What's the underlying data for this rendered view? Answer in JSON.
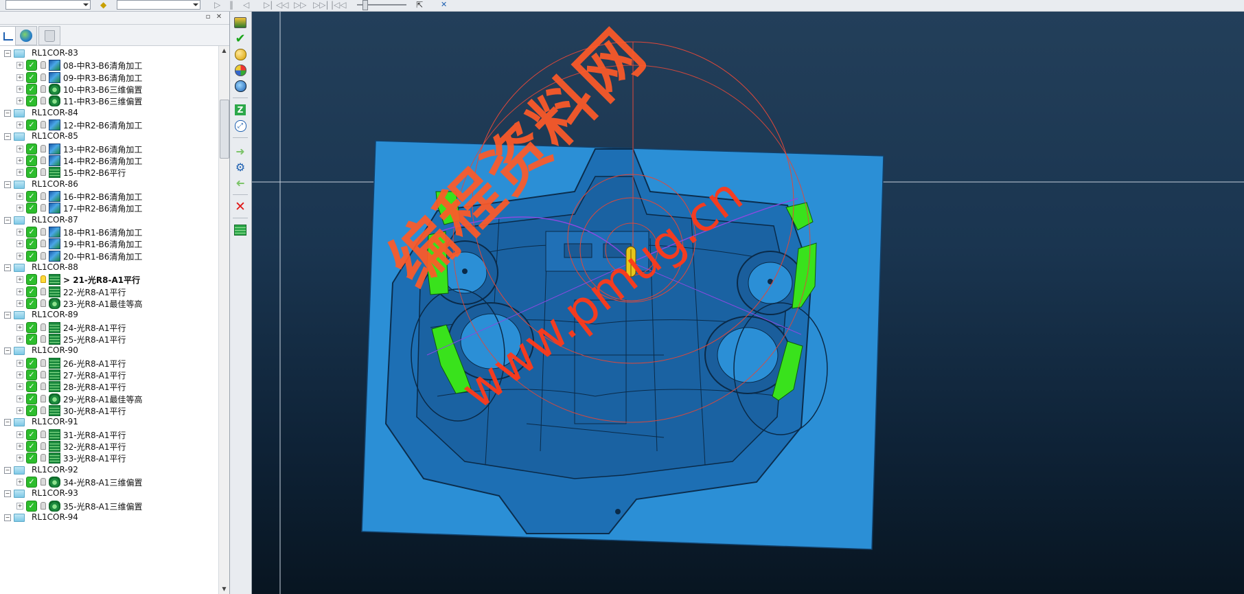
{
  "watermark": {
    "chinese": "编程资料网",
    "url": "www.pmug.cn"
  },
  "tree": {
    "rows": [
      {
        "kind": "group",
        "label": "RL1COR-83"
      },
      {
        "kind": "op",
        "label": "08-中R3-B6清角加工",
        "icon": "tool-corner-icon",
        "bulb": "off"
      },
      {
        "kind": "op",
        "label": "09-中R3-B6清角加工",
        "icon": "tool-corner-icon",
        "bulb": "off"
      },
      {
        "kind": "op",
        "label": "10-中R3-B6三维偏置",
        "icon": "tool-offset-icon",
        "bulb": "off"
      },
      {
        "kind": "op",
        "label": "11-中R3-B6三维偏置",
        "icon": "tool-offset-icon",
        "bulb": "off"
      },
      {
        "kind": "group",
        "label": "RL1COR-84"
      },
      {
        "kind": "op",
        "label": "12-中R2-B6清角加工",
        "icon": "tool-corner-icon",
        "bulb": "off"
      },
      {
        "kind": "group",
        "label": "RL1COR-85"
      },
      {
        "kind": "op",
        "label": "13-中R2-B6清角加工",
        "icon": "tool-corner-icon",
        "bulb": "off"
      },
      {
        "kind": "op",
        "label": "14-中R2-B6清角加工",
        "icon": "tool-corner-icon",
        "bulb": "off"
      },
      {
        "kind": "op",
        "label": "15-中R2-B6平行",
        "icon": "tool-parallel-icon",
        "bulb": "off"
      },
      {
        "kind": "group",
        "label": "RL1COR-86"
      },
      {
        "kind": "op",
        "label": "16-中R2-B6清角加工",
        "icon": "tool-corner-icon",
        "bulb": "off"
      },
      {
        "kind": "op",
        "label": "17-中R2-B6清角加工",
        "icon": "tool-corner-icon",
        "bulb": "off"
      },
      {
        "kind": "group",
        "label": "RL1COR-87"
      },
      {
        "kind": "op",
        "label": "18-中R1-B6清角加工",
        "icon": "tool-corner-icon",
        "bulb": "off"
      },
      {
        "kind": "op",
        "label": "19-中R1-B6清角加工",
        "icon": "tool-corner-icon",
        "bulb": "off"
      },
      {
        "kind": "op",
        "label": "20-中R1-B6清角加工",
        "icon": "tool-corner-icon",
        "bulb": "off"
      },
      {
        "kind": "group",
        "label": "RL1COR-88"
      },
      {
        "kind": "op",
        "label": "> 21-光R8-A1平行",
        "icon": "tool-parallel-icon",
        "bulb": "on",
        "selected": true
      },
      {
        "kind": "op",
        "label": "22-光R8-A1平行",
        "icon": "tool-parallel-icon",
        "bulb": "off"
      },
      {
        "kind": "op",
        "label": "23-光R8-A1最佳等高",
        "icon": "tool-zlevel-icon",
        "bulb": "off"
      },
      {
        "kind": "group",
        "label": "RL1COR-89"
      },
      {
        "kind": "op",
        "label": "24-光R8-A1平行",
        "icon": "tool-parallel-icon",
        "bulb": "off"
      },
      {
        "kind": "op",
        "label": "25-光R8-A1平行",
        "icon": "tool-parallel-icon",
        "bulb": "off"
      },
      {
        "kind": "group",
        "label": "RL1COR-90"
      },
      {
        "kind": "op",
        "label": "26-光R8-A1平行",
        "icon": "tool-parallel-icon",
        "bulb": "off"
      },
      {
        "kind": "op",
        "label": "27-光R8-A1平行",
        "icon": "tool-parallel-icon",
        "bulb": "off"
      },
      {
        "kind": "op",
        "label": "28-光R8-A1平行",
        "icon": "tool-parallel-icon",
        "bulb": "off"
      },
      {
        "kind": "op",
        "label": "29-光R8-A1最佳等高",
        "icon": "tool-zlevel-icon",
        "bulb": "off"
      },
      {
        "kind": "op",
        "label": "30-光R8-A1平行",
        "icon": "tool-parallel-icon",
        "bulb": "off"
      },
      {
        "kind": "group",
        "label": "RL1COR-91"
      },
      {
        "kind": "op",
        "label": "31-光R8-A1平行",
        "icon": "tool-parallel-icon",
        "bulb": "off"
      },
      {
        "kind": "op",
        "label": "32-光R8-A1平行",
        "icon": "tool-parallel-icon",
        "bulb": "off"
      },
      {
        "kind": "op",
        "label": "33-光R8-A1平行",
        "icon": "tool-parallel-icon",
        "bulb": "off"
      },
      {
        "kind": "group",
        "label": "RL1COR-92"
      },
      {
        "kind": "op",
        "label": "34-光R8-A1三维偏置",
        "icon": "tool-offset-icon",
        "bulb": "off"
      },
      {
        "kind": "group",
        "label": "RL1COR-93"
      },
      {
        "kind": "op",
        "label": "35-光R8-A1三维偏置",
        "icon": "tool-offset-icon",
        "bulb": "off"
      },
      {
        "kind": "group",
        "label": "RL1COR-94"
      }
    ]
  },
  "colors": {
    "part_blue": "#2b8fd6",
    "toolpath_green": "#39e21c",
    "boundary_red": "#e0483a",
    "watermark": "#ff5a28"
  }
}
